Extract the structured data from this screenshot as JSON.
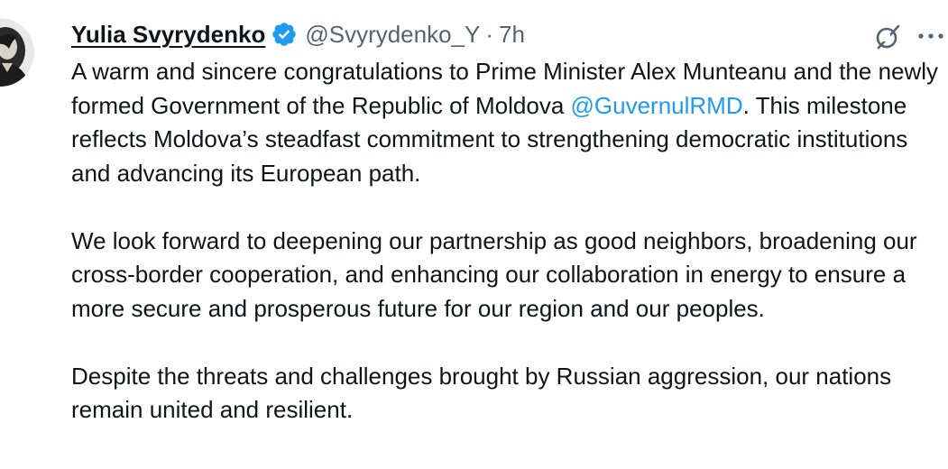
{
  "author": {
    "display_name": "Yulia Svyrydenko",
    "handle": "@Svyrydenko_Y",
    "separator": "·",
    "time": "7h",
    "verified": true
  },
  "icons": {
    "avatar": "profile-photo",
    "verified": "verified-badge-icon",
    "grok": "grok-icon",
    "more": "more-options-icon"
  },
  "colors": {
    "text": "#0f1419",
    "secondary_text": "#536471",
    "link": "#1d9bf0",
    "verified_badge": "#1d9bf0"
  },
  "post": {
    "p1_text": "A warm and sincere congratulations to Prime Minister Alex Munteanu and the newly formed Government of the Republic of Moldova ",
    "p1_mention": "@GuvernulRMD",
    "p1_tail": ". This milestone reflects Moldova’s steadfast commitment to strengthening democratic institutions and advancing its European path.",
    "p2": "We look forward to deepening our partnership as good neighbors, broadening our cross-border cooperation, and enhancing our collaboration in energy to ensure a more secure and prosperous future for our region and our peoples.",
    "p3": "Despite the threats and challenges brought by Russian aggression, our nations remain united and resilient."
  }
}
